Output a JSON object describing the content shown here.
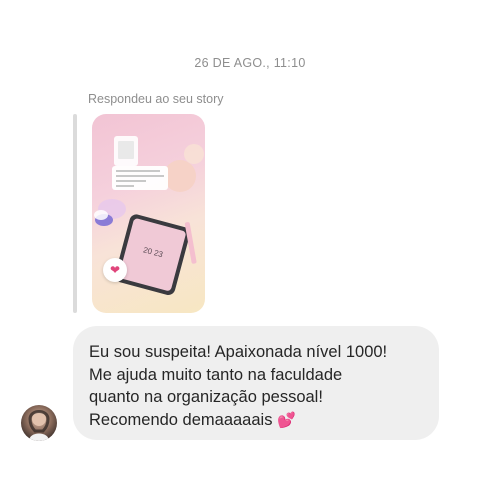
{
  "thread": {
    "timestamp": "26 DE AGO., 11:10",
    "reply_context": "Respondeu ao seu story"
  },
  "story": {
    "reaction_icon": "heart-icon",
    "tablet_screen_text": "20 23"
  },
  "message": {
    "lines": [
      "Eu sou suspeita! Apaixonada nível 1000!",
      "Me ajuda muito tanto na faculdade",
      "quanto na organização pessoal!",
      "Recomendo demaaaaais"
    ],
    "emoji": "💕"
  },
  "colors": {
    "bubble": "#efefef",
    "meta_text": "#8e8e8e",
    "message_text": "#262626"
  }
}
